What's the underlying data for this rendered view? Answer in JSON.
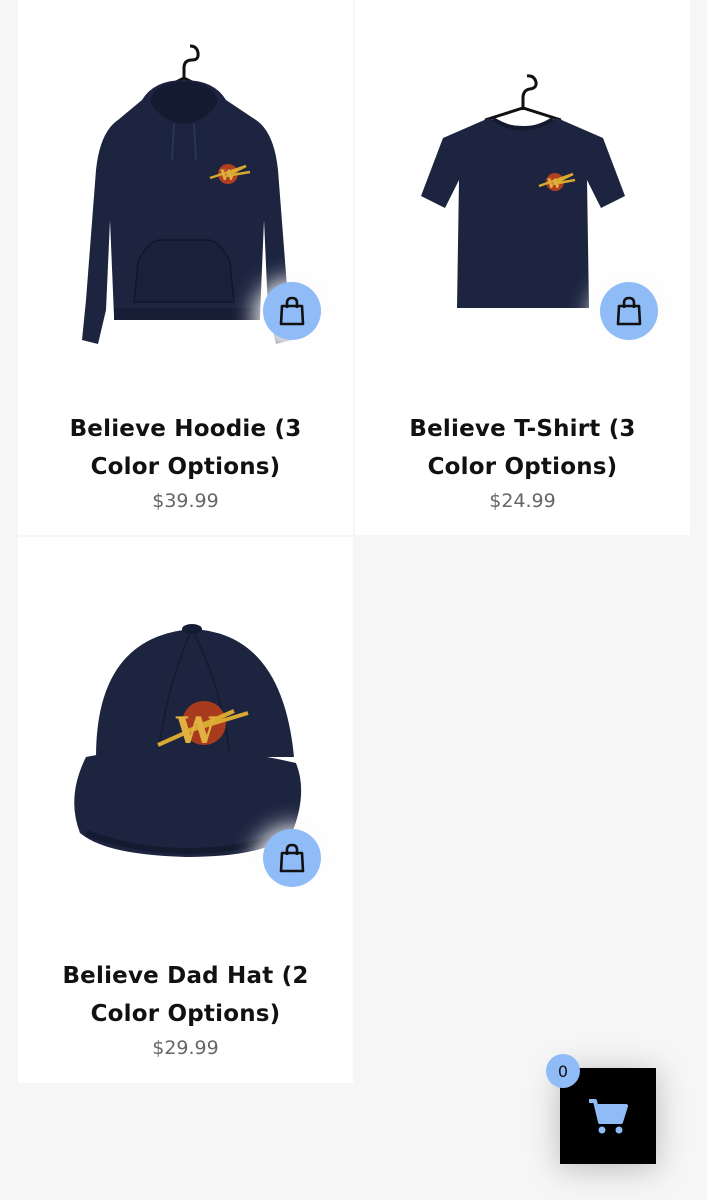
{
  "products": [
    {
      "title": "Believe Hoodie (3 Color Options)",
      "price": "$39.99",
      "image": "navy-hoodie-with-w-logo"
    },
    {
      "title": "Believe T-Shirt (3 Color Options)",
      "price": "$24.99",
      "image": "navy-tshirt-with-w-logo"
    },
    {
      "title": "Believe Dad Hat (2 Color Options)",
      "price": "$29.99",
      "image": "navy-cap-with-w-logo"
    }
  ],
  "cart": {
    "count": "0",
    "icon": "shopping-cart-icon"
  },
  "icons": {
    "add_to_cart": "shopping-bag-icon"
  },
  "colors": {
    "accent": "#8fbcf7",
    "garment": "#1c2440",
    "background": "#f6f6f6",
    "cart_button": "#000000"
  }
}
